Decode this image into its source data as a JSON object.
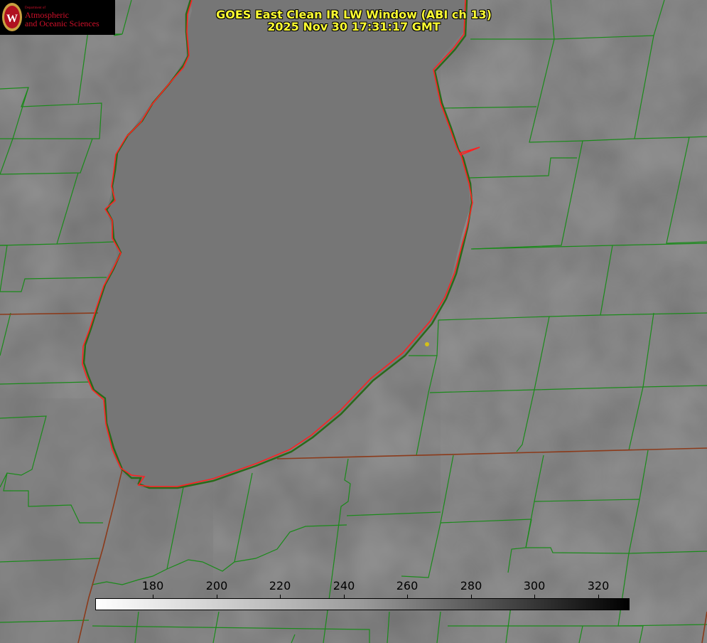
{
  "title": {
    "line1": "GOES East Clean IR LW Window (ABI ch 13)",
    "line2": "2025 Nov 30 17:31:17 GMT"
  },
  "logo": {
    "department": "Department of",
    "name_line1": "Atmospheric",
    "name_line2": "and Oceanic Sciences",
    "seal_letter": "W"
  },
  "colorbar": {
    "labels": [
      "180",
      "200",
      "220",
      "240",
      "260",
      "280",
      "300",
      "320"
    ]
  },
  "colors": {
    "background_gray": "#6f6f6f",
    "lake_gray": "#707070",
    "county_lines": "#1a8a1a",
    "state_lines": "#8b3a1a",
    "shoreline": "#ff2020",
    "title_text": "#ffff33",
    "marker": "#d4c018",
    "logo_text": "#d0102a"
  },
  "map": {
    "features": [
      "lake",
      "shoreline",
      "county-boundaries",
      "state-boundaries",
      "location-marker"
    ]
  }
}
